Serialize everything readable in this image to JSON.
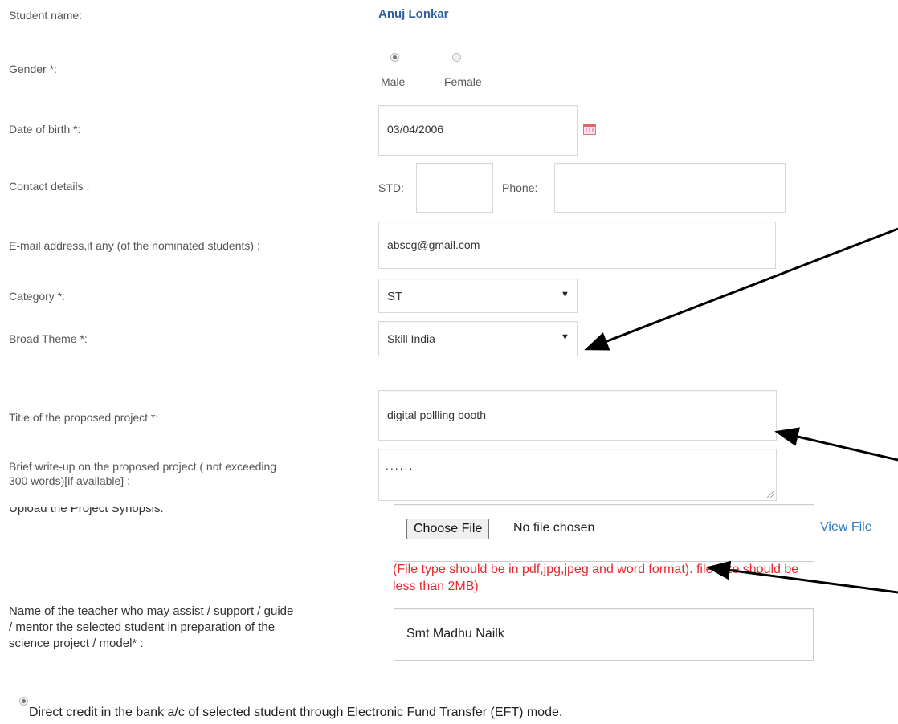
{
  "student": {
    "label": "Student name:",
    "value": "Anuj Lonkar"
  },
  "gender": {
    "label": "Gender *:",
    "options": [
      "Male",
      "Female"
    ],
    "selected": "Male"
  },
  "dob": {
    "label": "Date of birth *:",
    "value": "03/04/2006",
    "icon": "calendar-icon"
  },
  "contact": {
    "label": "Contact details :",
    "std_label": "STD:",
    "std_value": "",
    "phone_label": "Phone:",
    "phone_value": ""
  },
  "email": {
    "label": "E-mail address,if any (of the nominated students) :",
    "value": "abscg@gmail.com"
  },
  "category": {
    "label": "Category *:",
    "value": "ST"
  },
  "theme": {
    "label": "Broad Theme *:",
    "value": "Skill India"
  },
  "title": {
    "label": "Title of the proposed project *:",
    "value": "digital pollling booth"
  },
  "writeup": {
    "label_line1": "Brief write-up on the proposed project ( not exceeding",
    "label_line2": "300 words)[if available] :",
    "value": "......"
  },
  "synopsis": {
    "label": "Upload the Project Synopsis:",
    "button": "Choose File",
    "status": "No file chosen",
    "view_link": "View File",
    "note_line1": "(File type should be in pdf,jpg,jpeg and word format). file size should be",
    "note_line2": "less than 2MB)"
  },
  "teacher": {
    "label_line1": "Name of the teacher who may assist / support / guide",
    "label_line2": "/ mentor the selected student in preparation of the",
    "label_line3": "science project / model* :",
    "value": "Smt Madhu Nailk"
  },
  "payment": {
    "option_text": "Direct credit in the bank a/c of selected student through Electronic Fund Transfer (EFT) mode."
  },
  "colors": {
    "link": "#2a7bc4",
    "note": "#e8262d",
    "student_name": "#2f5f9e",
    "annotation_arrow": "#000000"
  }
}
